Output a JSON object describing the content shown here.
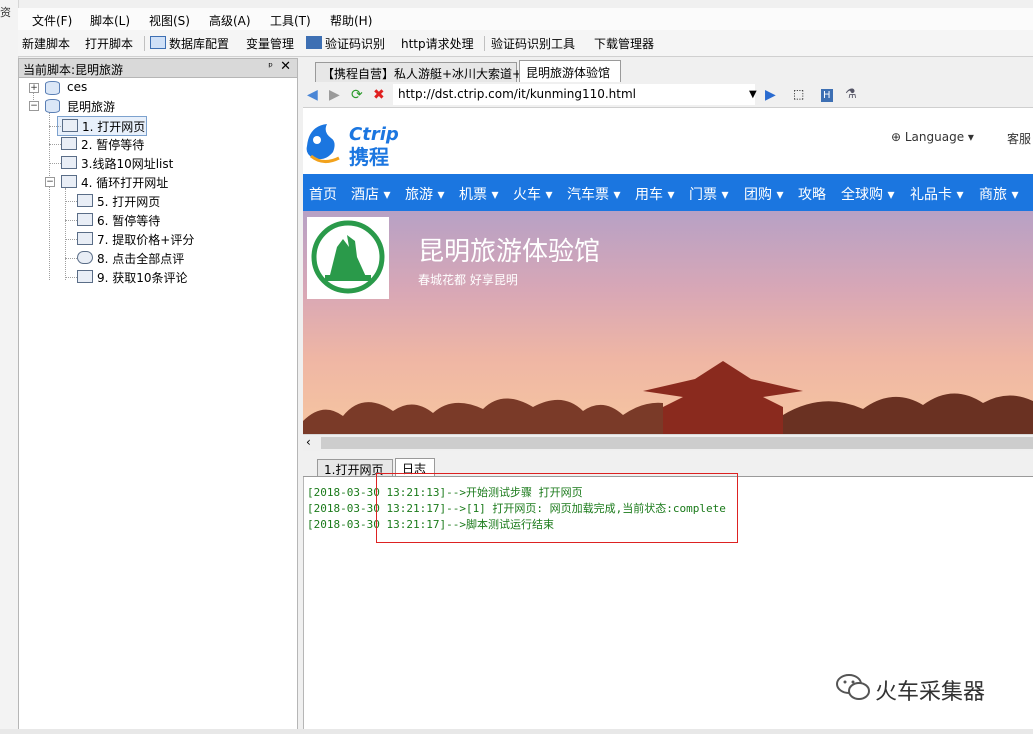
{
  "left_stub_text": "资",
  "menu": [
    "文件(F)",
    "脚本(L)",
    "视图(S)",
    "高级(A)",
    "工具(T)",
    "帮助(H)"
  ],
  "toolbar": {
    "new_script": "新建脚本",
    "open_script": "打开脚本",
    "db_config": "数据库配置",
    "var_manage": "变量管理",
    "captcha": "验证码识别",
    "http": "http请求处理",
    "captcha_tool": "验证码识别工具",
    "download_manager": "下载管理器"
  },
  "panel": {
    "title": "当前脚本:昆明旅游",
    "pin": "ᵖ",
    "close": "✕"
  },
  "tree": {
    "root1": "ces",
    "root2": "昆明旅游",
    "items": [
      {
        "label": "1. 打开网页"
      },
      {
        "label": "2. 暂停等待"
      },
      {
        "label": "3.线路10网址list"
      },
      {
        "label": "4. 循环打开网址"
      },
      {
        "label": "5. 打开网页"
      },
      {
        "label": "6. 暂停等待"
      },
      {
        "label": "7. 提取价格+评分"
      },
      {
        "label": "8. 点击全部点评"
      },
      {
        "label": "9. 获取10条评论"
      }
    ]
  },
  "tabs": {
    "tab1": "【携程自营】私人游艇+冰川大索道+",
    "tab2": "昆明旅游体验馆"
  },
  "address": {
    "url": "http://dst.ctrip.com/it/kunming110.html"
  },
  "web": {
    "logo_latin": "Ctrip",
    "logo_cn": "携程",
    "language": "Language ▾",
    "service": "客服",
    "nav": [
      "首页",
      "酒店 ▾",
      "旅游 ▾",
      "机票 ▾",
      "火车 ▾",
      "汽车票 ▾",
      "用车 ▾",
      "门票 ▾",
      "团购 ▾",
      "攻略",
      "全球购 ▾",
      "礼品卡 ▾",
      "商旅 ▾"
    ],
    "banner_title": "昆明旅游体验馆",
    "banner_sub": "春城花都 好享昆明"
  },
  "bottom_tabs": {
    "tab1": "1.打开网页",
    "tab2": "日志"
  },
  "log": [
    "[2018-03-30 13:21:13]-->开始测试步骤 打开网页",
    "[2018-03-30 13:21:17]-->[1] 打开网页: 网页加载完成,当前状态:complete",
    "[2018-03-30 13:21:17]-->脚本测试运行结束"
  ],
  "watermark": "火车采集器",
  "colors": {
    "nav_blue": "#1b76e0",
    "log_green": "#1a7a1a",
    "highlight_red": "#dd2222"
  }
}
